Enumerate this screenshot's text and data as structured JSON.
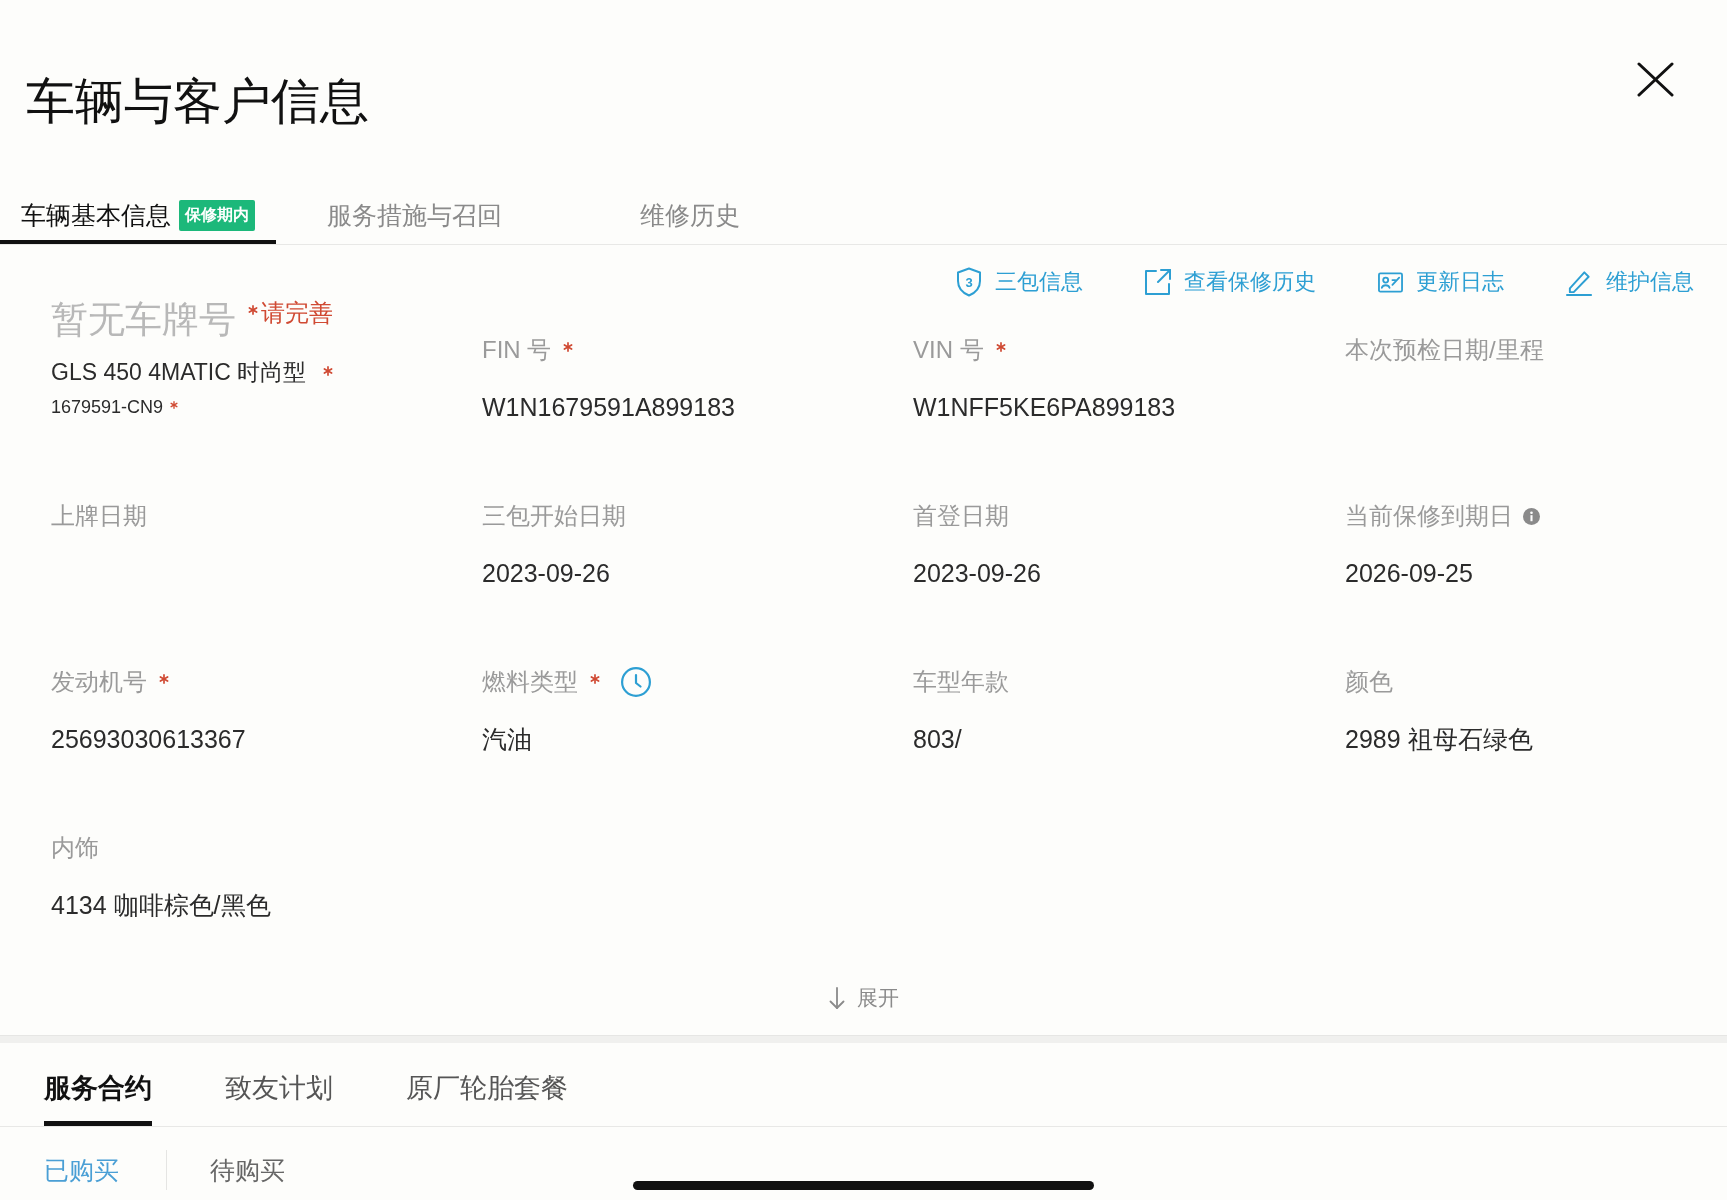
{
  "window": {
    "title": "车辆与客户信息"
  },
  "tabs": [
    {
      "label": "车辆基本信息",
      "selected": true,
      "badge": "保修期内"
    },
    {
      "label": "服务措施与召回",
      "selected": false
    },
    {
      "label": "维修历史",
      "selected": false
    }
  ],
  "actions": [
    {
      "label": "三包信息",
      "icon_text": "3"
    },
    {
      "label": "查看保修历史"
    },
    {
      "label": "更新日志"
    },
    {
      "label": "维护信息"
    }
  ],
  "vehicle": {
    "plate": "暂无车牌号",
    "plate_required": true,
    "plate_note": "请完善",
    "model": "GLS 450 4MATIC 时尚型",
    "model_required": true,
    "code": "1679591-CN9",
    "code_required": true
  },
  "fields": [
    {
      "label": "FIN 号",
      "required": true,
      "kind": "plain",
      "value": "W1N1679591A899183"
    },
    {
      "label": "VIN 号",
      "required": true,
      "kind": "plain",
      "value": "W1NFF5KE6PA899183"
    },
    {
      "label": "本次预检日期/里程",
      "required": false,
      "kind": "plain"
    },
    {
      "label": "上牌日期",
      "required": false,
      "kind": "plain"
    },
    {
      "label": "三包开始日期",
      "required": false,
      "kind": "plain",
      "value": "2023-09-26"
    },
    {
      "label": "首登日期",
      "required": false,
      "kind": "plain",
      "value": "2023-09-26"
    },
    {
      "label": "当前保修到期日",
      "required": false,
      "kind": "info",
      "value": "2026-09-25"
    },
    {
      "label": "发动机号",
      "required": true,
      "kind": "plain",
      "value": "25693030613367"
    },
    {
      "label": "燃料类型",
      "required": true,
      "kind": "history",
      "value": "汽油"
    },
    {
      "label": "车型年款",
      "required": false,
      "kind": "plain",
      "value": "803/"
    },
    {
      "label": "颜色",
      "required": false,
      "kind": "plain",
      "value": "2989 祖母石绿色"
    },
    {
      "label": "内饰",
      "required": false,
      "kind": "plain",
      "value": "4134 咖啡棕色/黑色"
    }
  ],
  "expand": {
    "label": "展开"
  },
  "contract_tabs": [
    {
      "label": "服务合约",
      "selected": true
    },
    {
      "label": "致友计划",
      "selected": false
    },
    {
      "label": "原厂轮胎套餐",
      "selected": false
    }
  ],
  "purchase_tabs": [
    {
      "label": "已购买",
      "selected": true
    },
    {
      "label": "待购买",
      "selected": false
    }
  ]
}
